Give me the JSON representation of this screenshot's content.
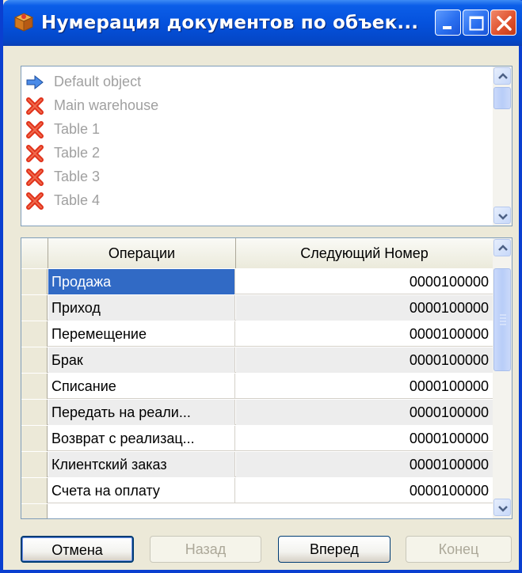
{
  "window": {
    "title": "Нумерация документов по объек...",
    "app_icon": "box-icon"
  },
  "objects": {
    "items": [
      {
        "label": "Default object",
        "icon": "arrow-right-icon"
      },
      {
        "label": "Main warehouse",
        "icon": "red-x-icon"
      },
      {
        "label": "Table 1",
        "icon": "red-x-icon"
      },
      {
        "label": "Table 2",
        "icon": "red-x-icon"
      },
      {
        "label": "Table 3",
        "icon": "red-x-icon"
      },
      {
        "label": "Table 4",
        "icon": "red-x-icon"
      }
    ]
  },
  "grid": {
    "headers": [
      "Операции",
      "Следующий Номер"
    ],
    "rows": [
      {
        "operation": "Продажа",
        "next_number": "0000100000"
      },
      {
        "operation": "Приход",
        "next_number": "0000100000"
      },
      {
        "operation": "Перемещение",
        "next_number": "0000100000"
      },
      {
        "operation": "Брак",
        "next_number": "0000100000"
      },
      {
        "operation": "Списание",
        "next_number": "0000100000"
      },
      {
        "operation": "Передать на реали...",
        "next_number": "0000100000"
      },
      {
        "operation": "Возврат с реализац...",
        "next_number": "0000100000"
      },
      {
        "operation": "Клиентский заказ",
        "next_number": "0000100000"
      },
      {
        "operation": "Счета на оплату",
        "next_number": "0000100000"
      }
    ]
  },
  "buttons": {
    "cancel": "Отмена",
    "back": "Назад",
    "next": "Вперед",
    "finish": "Конец"
  },
  "colors": {
    "titlebar": "#0552DD",
    "selection": "#316AC5",
    "disabled_text": "#A0A0A0"
  }
}
